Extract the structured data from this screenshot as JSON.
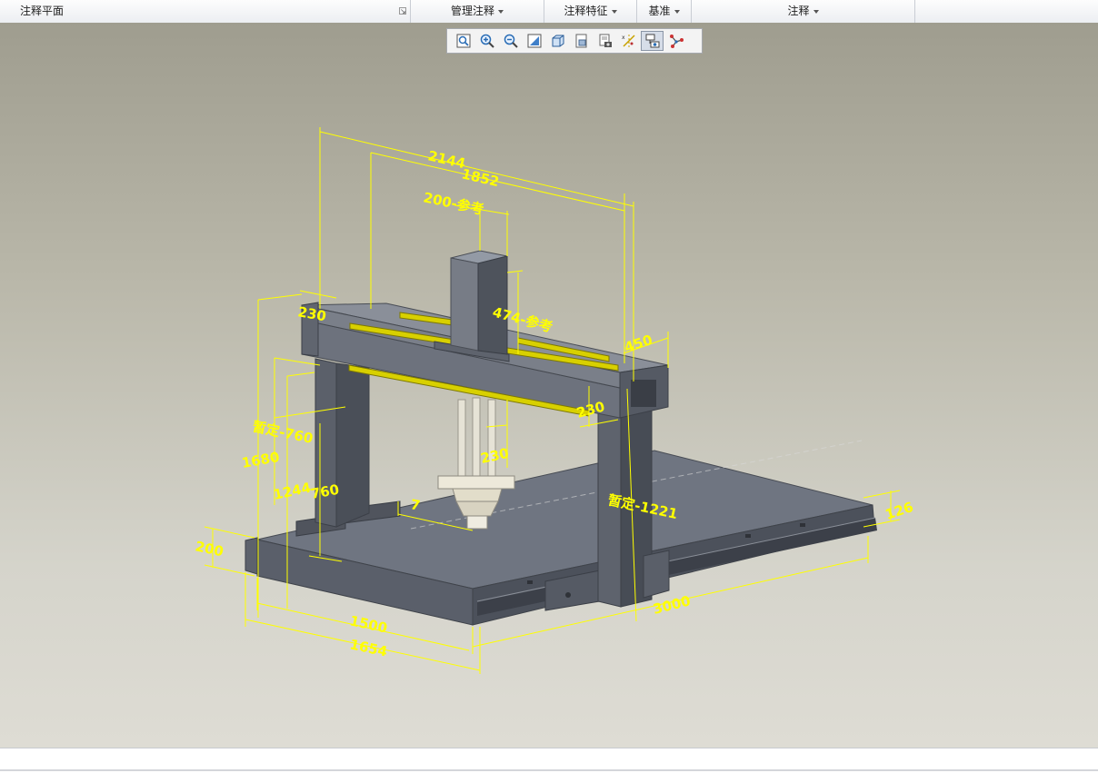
{
  "ribbon": {
    "groups": [
      {
        "label": "注释平面"
      },
      {
        "label": "管理注释"
      },
      {
        "label": "注释特征"
      },
      {
        "label": "基准"
      },
      {
        "label": "注释"
      }
    ]
  },
  "graphics_toolbar": {
    "buttons": [
      {
        "icon": "refit-icon"
      },
      {
        "icon": "zoom-in-icon"
      },
      {
        "icon": "zoom-out-icon"
      },
      {
        "icon": "repaint-icon"
      },
      {
        "icon": "display-style-icon"
      },
      {
        "icon": "saved-orientations-icon"
      },
      {
        "icon": "view-manager-icon"
      },
      {
        "icon": "datum-display-icon"
      },
      {
        "icon": "annotation-display-icon"
      },
      {
        "icon": "spin-center-icon"
      }
    ]
  },
  "dimensions": {
    "d2144": "2144",
    "d1852": "1852",
    "d200_ref": "200-参考",
    "d474_ref": "474-参考",
    "d230_top": "230",
    "d450": "450",
    "d230_right": "230",
    "d230_mid": "230",
    "d760_tent": "暂定-760",
    "d1680": "1680",
    "d1244": "1244",
    "d760": "760",
    "d7": "7",
    "d200": "200",
    "d1221_tent": "暂定-1221",
    "d126": "126",
    "d3000": "3000",
    "d1500": "1500",
    "d1654": "1654"
  },
  "colors": {
    "annotation": "#ffff00",
    "steel": "#6f7480",
    "rail": "#d8d000"
  }
}
